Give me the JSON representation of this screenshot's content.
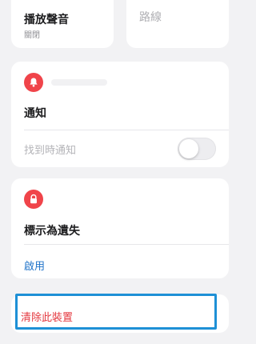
{
  "play_sound": {
    "title": "播放聲音",
    "status": "關閉"
  },
  "route": {
    "title": "路線"
  },
  "notifications": {
    "icon": "bell-icon",
    "title": "通知",
    "notify_when_found_label": "找到時通知",
    "notify_when_found_enabled": false
  },
  "mark_as_lost": {
    "icon": "lock-icon",
    "title": "標示為遺失",
    "enable_label": "啟用"
  },
  "remove_device": {
    "label": "清除此裝置"
  },
  "colors": {
    "accent_red": "#f0444a",
    "link_blue": "#1f73c9",
    "highlight_blue": "#1e90d6",
    "destructive_red": "#e4383f"
  }
}
